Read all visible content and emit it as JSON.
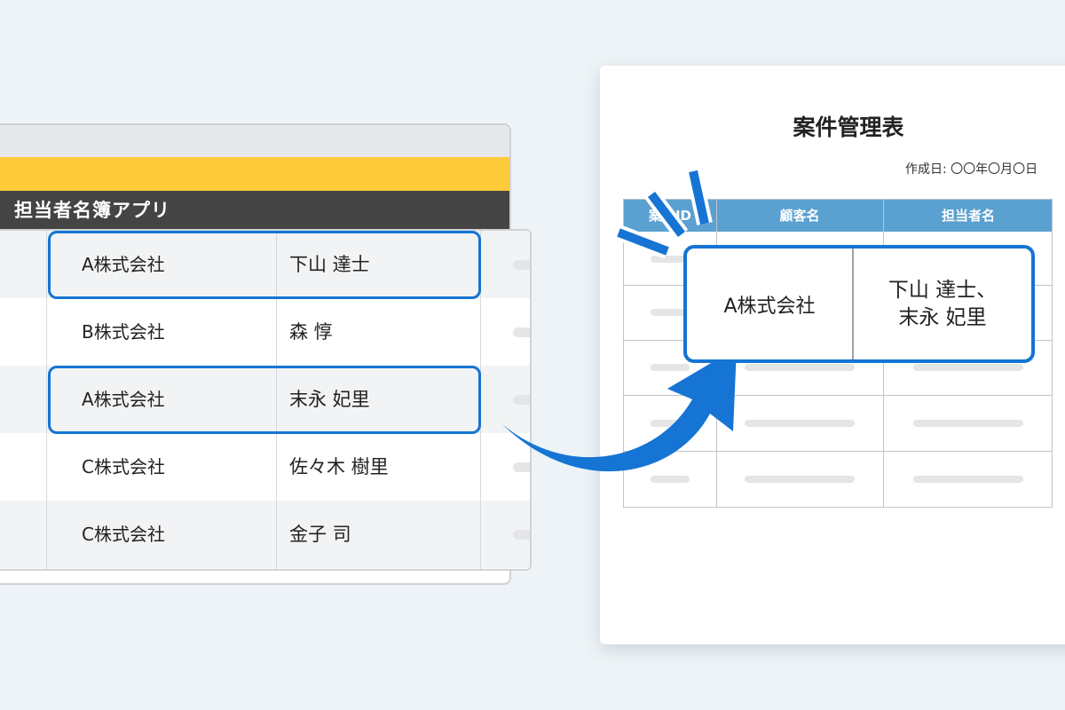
{
  "app": {
    "header_title": "担当者名簿アプリ",
    "rows": [
      {
        "company": "A株式会社",
        "person": "下山 達士",
        "highlighted": true
      },
      {
        "company": "B株式会社",
        "person": "森 惇",
        "highlighted": false
      },
      {
        "company": "A株式会社",
        "person": "末永 妃里",
        "highlighted": true
      },
      {
        "company": "C株式会社",
        "person": "佐々木 樹里",
        "highlighted": false
      },
      {
        "company": "C株式会社",
        "person": "金子 司",
        "highlighted": false
      }
    ]
  },
  "document": {
    "title": "案件管理表",
    "date_label": "作成日: 〇〇年〇月〇日",
    "columns": [
      "案件ID",
      "顧客名",
      "担当者名"
    ]
  },
  "merged_entry": {
    "company": "A株式会社",
    "persons_line1": "下山 達士、",
    "persons_line2": "末永 妃里"
  },
  "colors": {
    "background": "#edf3f6",
    "accent_yellow": "#ffcb3a",
    "header_dark": "#444444",
    "highlight_blue": "#1574d4",
    "table_header_blue": "#5aa0d0"
  }
}
